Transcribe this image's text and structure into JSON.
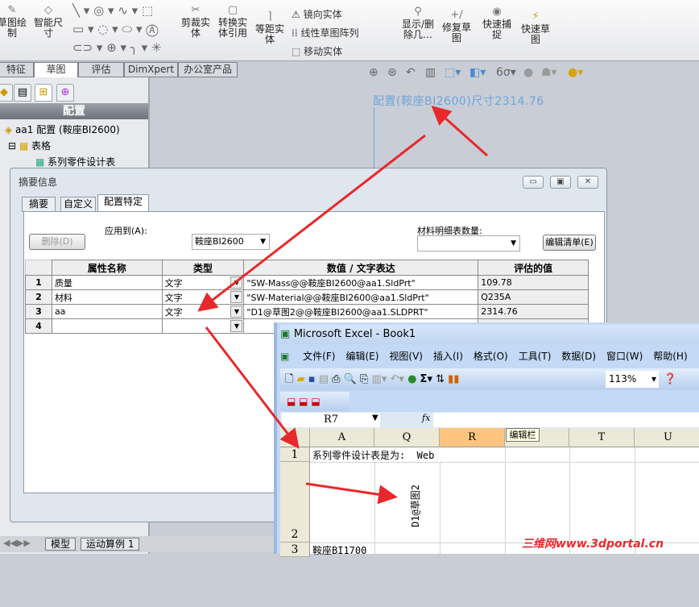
{
  "ribbon": {
    "buttons": [
      {
        "label": "草图绘制",
        "icon": "sketch-icon"
      },
      {
        "label": "智能尺寸",
        "icon": "smart-dimension-icon"
      },
      {
        "label": "剪裁实体",
        "icon": "trim-icon"
      },
      {
        "label": "转换实体引用",
        "icon": "convert-entities-icon"
      },
      {
        "label": "等距实体",
        "icon": "offset-icon"
      },
      {
        "label": "显示/删除几…",
        "icon": "display-delete-relations-icon"
      },
      {
        "label": "修复草图",
        "icon": "repair-sketch-icon"
      },
      {
        "label": "快速捕捉",
        "icon": "quick-snap-icon"
      },
      {
        "label": "快速草图",
        "icon": "rapid-sketch-icon"
      }
    ],
    "small": [
      {
        "label": "镜向实体",
        "icon": "mirror-icon"
      },
      {
        "label": "线性草图阵列",
        "icon": "linear-pattern-icon"
      },
      {
        "label": "移动实体",
        "icon": "move-icon"
      }
    ]
  },
  "tabs": [
    {
      "label": "特征"
    },
    {
      "label": "草图",
      "active": true
    },
    {
      "label": "评估"
    },
    {
      "label": "DimXpert"
    },
    {
      "label": "办公室产品"
    }
  ],
  "left_panel": {
    "header": "配置",
    "tree": [
      {
        "label": "aa1 配置  (鞍座BI2600)"
      },
      {
        "label": "表格"
      },
      {
        "label": "系列零件设计表"
      }
    ]
  },
  "graphics": {
    "dimension_text": "配置(鞍座BI2600)尺寸2314.76"
  },
  "dialog": {
    "title": "摘要信息",
    "tabs": [
      {
        "label": "摘要"
      },
      {
        "label": "自定义"
      },
      {
        "label": "配置特定",
        "active": true
      }
    ],
    "apply_to_label": "应用到(A):",
    "apply_to_value": "鞍座BI2600",
    "delete_button": "删除(D)",
    "bom_qty_label": "材料明细表数量:",
    "bom_qty_value": "",
    "edit_list_button": "编辑清单(E)",
    "columns": [
      "属性名称",
      "类型",
      "数值 / 文字表达",
      "评估的值"
    ],
    "rows": [
      {
        "n": "1",
        "name": "质量",
        "type": "文字",
        "expr": "\"SW-Mass@@鞍座BI2600@aa1.SldPrt\"",
        "value": "109.78"
      },
      {
        "n": "2",
        "name": "材料",
        "type": "文字",
        "expr": "\"SW-Material@@鞍座BI2600@aa1.SldPrt\"",
        "value": "Q235A"
      },
      {
        "n": "3",
        "name": "aa",
        "type": "文字",
        "expr": "\"D1@草图2@@鞍座BI2600@aa1.SLDPRT\"",
        "value": "2314.76"
      },
      {
        "n": "4",
        "name": "",
        "type": "",
        "expr": "",
        "value": ""
      }
    ]
  },
  "bottom_tabs": [
    {
      "label": "模型"
    },
    {
      "label": "运动算例 1"
    }
  ],
  "excel": {
    "title": "Microsoft Excel - Book1",
    "menu": [
      "文件(F)",
      "编辑(E)",
      "视图(V)",
      "插入(I)",
      "格式(O)",
      "工具(T)",
      "数据(D)",
      "窗口(W)",
      "帮助(H)"
    ],
    "zoom": "113%",
    "name_box": "R7",
    "fx": "fx",
    "tooltip": "编辑栏",
    "columns": [
      "A",
      "Q",
      "R",
      "S",
      "T",
      "U"
    ],
    "selected_column": "R",
    "rows": [
      {
        "n": "1",
        "a": "系列零件设计表是为:  Web"
      },
      {
        "n": "2",
        "q": "D1@草图2"
      },
      {
        "n": "3",
        "a": "鞍座BI1700"
      }
    ]
  },
  "watermark": "三维网www.3dportal.cn",
  "colors": {
    "arrow": "#e8282b",
    "dimension_text": "#6fa5dc",
    "excel_selected_col": "#ffc47f"
  }
}
